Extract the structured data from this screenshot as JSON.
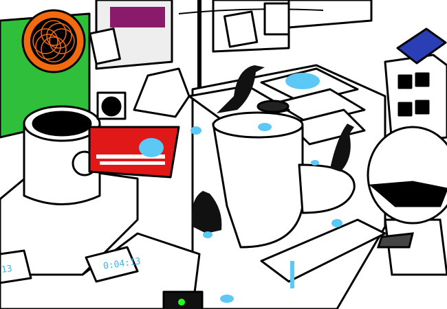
{
  "scene": {
    "timer_right": "0:04:13",
    "timer_left": "13"
  },
  "colors": {
    "outline": "#000000",
    "paint": "#5bc8f5",
    "sampler_red": "#e01818",
    "spiral_orange": "#f26a10",
    "poster_green": "#2fbf3a",
    "pad_blue": "#2a3fb5"
  }
}
